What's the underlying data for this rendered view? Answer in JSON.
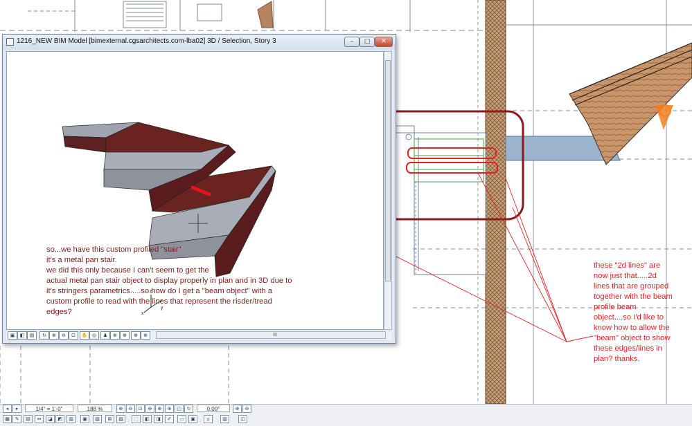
{
  "window": {
    "title": "1216_NEW BIM Model  [bimexternal.cgsarchitects.com-lba02] 3D / Selection, Story 3",
    "minimize": "‒",
    "maximize": "□",
    "close": "✕",
    "scroll_grip": "III"
  },
  "axes": {
    "x": "x",
    "y": "y",
    "z": "z"
  },
  "stair_note": {
    "lines": [
      "so...we have this custom profiled \"stair\"",
      "it's a metal pan stair.",
      "we did this only because I can't seem to get the",
      "actual metal pan stair object to display properly in plan and in 3D due to",
      "it's stringers parametrics.....so how do I get a \"beam object\" with a",
      "custom profile to read with the lines that represent the risder/tread",
      "edges?"
    ]
  },
  "side_note": {
    "lines": [
      "these \"2d lines\" are",
      "now just that.....2d",
      "lines that are grouped",
      "together with the beam",
      "profile beam",
      "object....so I'd like to",
      "know how to allow the",
      "\"beam\" object to show",
      "these edges/lines in",
      "plan? thanks."
    ]
  },
  "statusbar": {
    "scale": "1/4\"   =   1'-0\"",
    "zoom": "188 %",
    "angle": "0.00°"
  },
  "colors": {
    "annotation_dark_red": "#7b1c1c",
    "annotation_red": "#e52222",
    "stair_stringer": "#6b2320",
    "stair_tread": "#a9adb8",
    "beam_blue": "#9cb3cd"
  }
}
